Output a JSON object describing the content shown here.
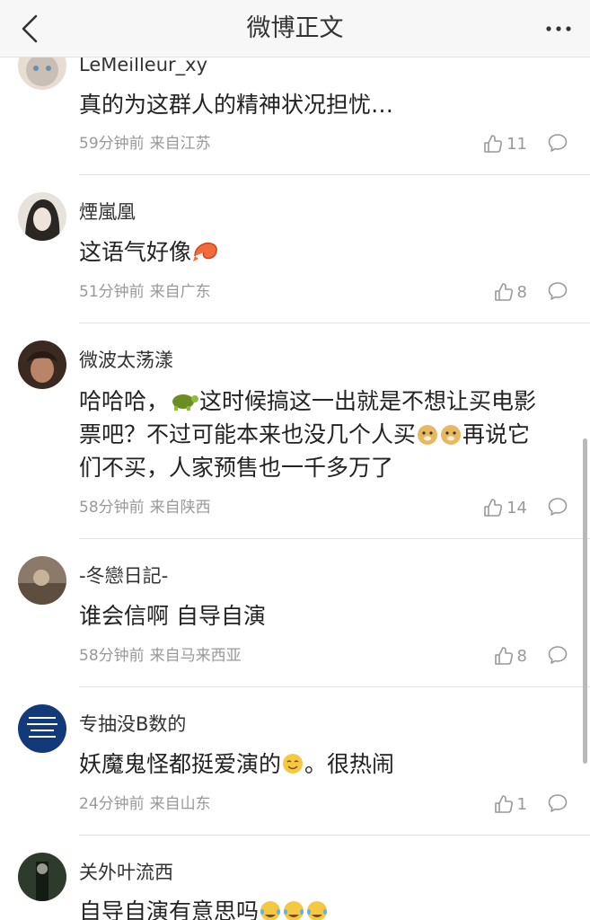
{
  "nav": {
    "title": "微博正文",
    "back_icon": "chevron-left-icon",
    "more_icon": "ellipsis-icon"
  },
  "comments": [
    {
      "username": "LeMeilleur_xy",
      "text": "真的为这群人的精神状况担忧…",
      "time": "59分钟前",
      "source": "来自江苏",
      "likes": "11"
    },
    {
      "username": "煙嵐凰",
      "text_parts": [
        "这语气好像"
      ],
      "emoji_after": "shrimp-emoji",
      "time": "51分钟前",
      "source": "来自广东",
      "likes": "8"
    },
    {
      "username": "微波太荡漾",
      "text_line1_a": "哈哈哈，",
      "text_line1_b": "这时候搞这一出就是不想让买电影",
      "text_line2_a": "票吧？不过可能本来也没几个人买",
      "text_line2_b": "再说它",
      "text_line3": "们不买，人家预售也一千多万了",
      "time": "58分钟前",
      "source": "来自陕西",
      "likes": "14"
    },
    {
      "username": "-冬戀日記-",
      "text": "谁会信啊 自导自演",
      "time": "58分钟前",
      "source": "来自马来西亚",
      "likes": "8"
    },
    {
      "username": "专抽没B数的",
      "text_a": "妖魔鬼怪都挺爱演的",
      "text_b": "。很热闹",
      "time": "24分钟前",
      "source": "来自山东",
      "likes": "1"
    },
    {
      "username": "关外叶流西",
      "text": "自导自演有意思吗"
    }
  ],
  "colors": {
    "nav_bg": "#f7f7f7",
    "meta": "#999999",
    "divider": "#e4e4e4"
  }
}
